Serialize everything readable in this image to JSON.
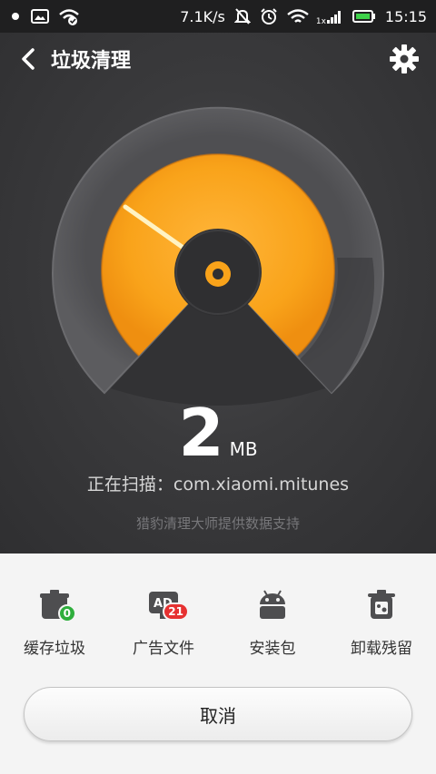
{
  "status_bar": {
    "network_speed": "7.1K/s",
    "time": "15:15",
    "signal_label": "1x",
    "icons": [
      "notification-dot-icon",
      "image-icon",
      "wifi-check-icon",
      "mute-icon",
      "alarm-icon",
      "wifi-icon",
      "signal-icon",
      "battery-icon"
    ]
  },
  "header": {
    "title": "垃圾清理",
    "back_icon": "chevron-left-icon",
    "settings_icon": "gear-icon"
  },
  "scan": {
    "size_value": "2",
    "size_unit": "MB",
    "status_text": "正在扫描：com.xiaomi.mitunes",
    "provider_text": "猎豹清理大师提供数据支持"
  },
  "categories": [
    {
      "label": "缓存垃圾",
      "icon": "cache-trash-icon",
      "badge": "0"
    },
    {
      "label": "广告文件",
      "icon": "ad-file-icon",
      "badge": "21"
    },
    {
      "label": "安装包",
      "icon": "android-package-icon"
    },
    {
      "label": "卸载残留",
      "icon": "uninstall-residue-icon"
    }
  ],
  "actions": {
    "cancel_label": "取消"
  },
  "colors": {
    "accent_orange": "#f9a31a",
    "gauge_dark": "#333335",
    "badge_green": "#2eae3c",
    "badge_red": "#e63131"
  }
}
